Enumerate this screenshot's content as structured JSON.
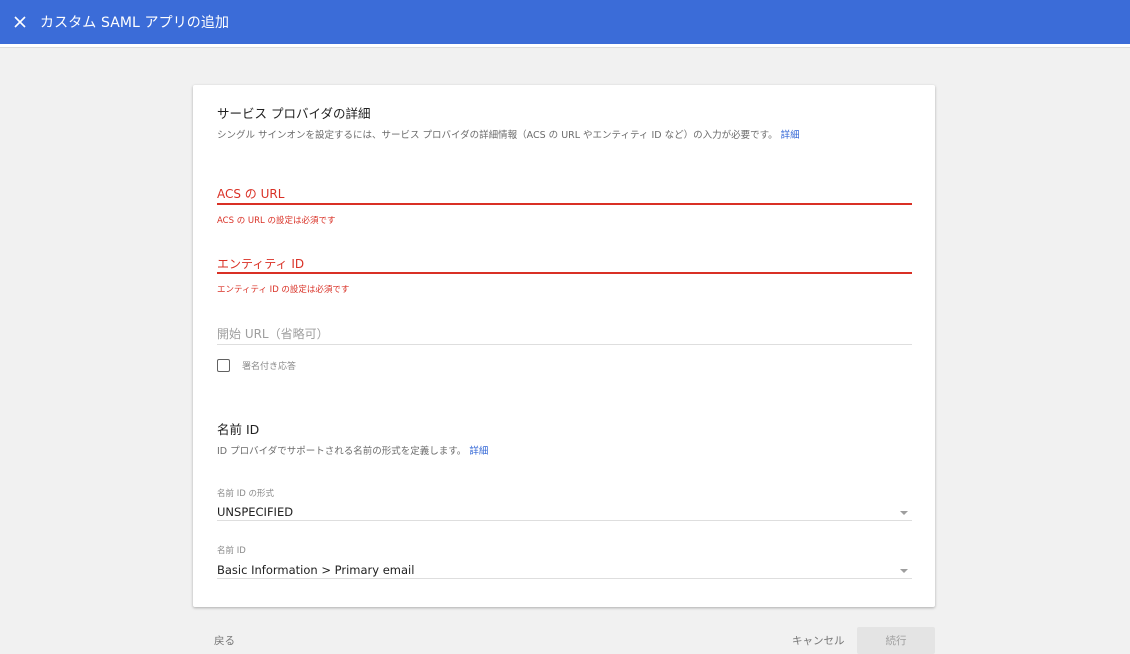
{
  "header": {
    "close_icon": "close-icon",
    "title": "カスタム SAML アプリの追加",
    "color": "#3b6cd8"
  },
  "sp_details": {
    "title": "サービス プロバイダの詳細",
    "description": "シングル サインオンを設定するには、サービス プロバイダの詳細情報（ACS の URL やエンティティ ID など）の入力が必要です。",
    "link": "詳細"
  },
  "fields": {
    "acs_url": {
      "label": "ACS の URL",
      "error": "ACS の URL の設定は必須です"
    },
    "entity_id": {
      "label": "エンティティ ID",
      "error": "エンティティ ID の設定は必須です"
    },
    "start_url": {
      "placeholder": "開始 URL（省略可）"
    },
    "signed_response": {
      "label": "署名付き応答",
      "checked": false
    }
  },
  "name_id": {
    "title": "名前 ID",
    "description": "ID プロバイダでサポートされる名前の形式を定義します。",
    "link": "詳細",
    "format": {
      "label": "名前 ID の形式",
      "value": "UNSPECIFIED"
    },
    "name_id": {
      "label": "名前 ID",
      "value": "Basic Information > Primary email"
    }
  },
  "footer": {
    "back": "戻る",
    "cancel": "キャンセル",
    "continue": "続行"
  },
  "colors": {
    "error": "#d93025",
    "link": "#3367d6",
    "background": "#f1f1f1"
  }
}
